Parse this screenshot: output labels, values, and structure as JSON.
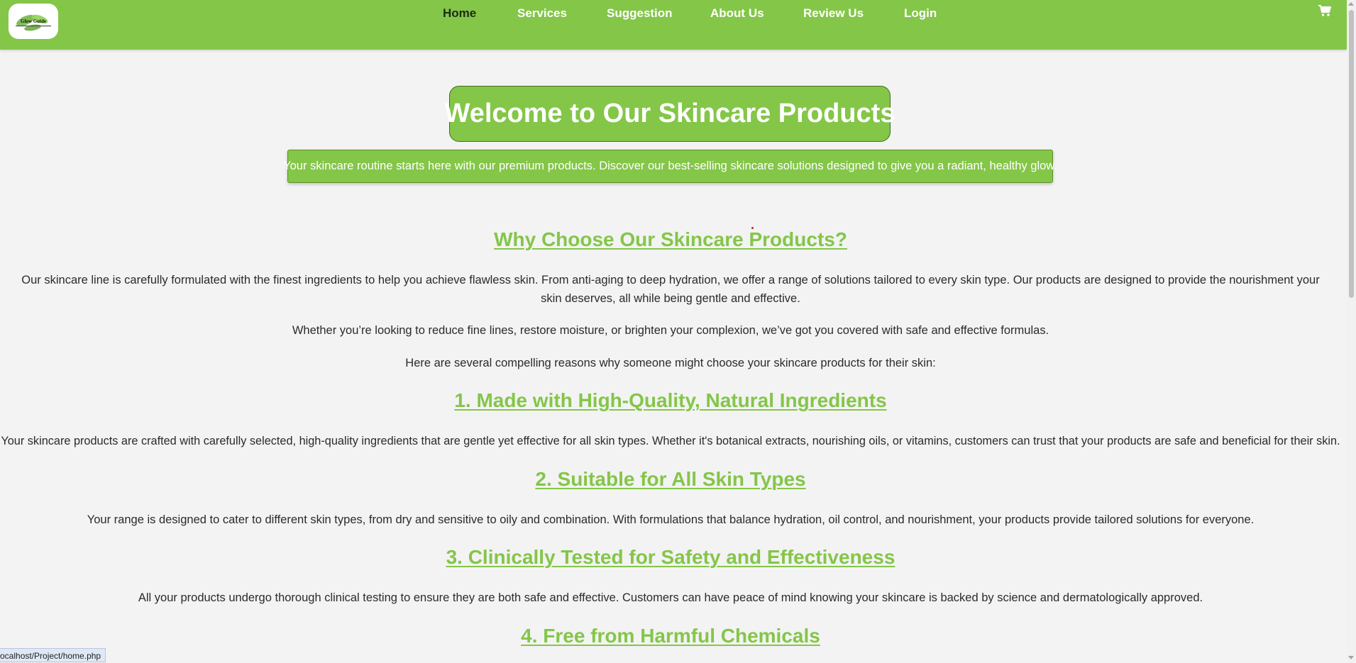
{
  "nav": {
    "logo_text": "Glow Guide",
    "items": [
      "Home",
      "Services",
      "Suggestion",
      "About Us",
      "Review Us",
      "Login"
    ],
    "active": "Home"
  },
  "hero": {
    "title": "Welcome to Our Skincare Products",
    "subtitle": "Your skincare routine starts here with our premium products. Discover our best-selling skincare solutions designed to give you a radiant, healthy glow."
  },
  "why": {
    "heading": "Why Choose Our Skincare Products?",
    "p1": "Our skincare line is carefully formulated with the finest ingredients to help you achieve flawless skin. From anti-aging to deep hydration, we offer a range of solutions tailored to every skin type. Our products are designed to provide the nourishment your skin deserves, all while being gentle and effective.",
    "p2": "Whether you’re looking to reduce fine lines, restore moisture, or brighten your complexion, we’ve got you covered with safe and effective formulas.",
    "p3": "Here are several compelling reasons why someone might choose your skincare products for their skin:"
  },
  "reasons": [
    {
      "heading": "1. Made with High-Quality, Natural Ingredients",
      "text": "Your skincare products are crafted with carefully selected, high-quality ingredients that are gentle yet effective for all skin types. Whether it's botanical extracts, nourishing oils, or vitamins, customers can trust that your products are safe and beneficial for their skin."
    },
    {
      "heading": "2. Suitable for All Skin Types",
      "text": "Your range is designed to cater to different skin types, from dry and sensitive to oily and combination. With formulations that balance hydration, oil control, and nourishment, your products provide tailored solutions for everyone."
    },
    {
      "heading": "3. Clinically Tested for Safety and Effectiveness",
      "text": "All your products undergo thorough clinical testing to ensure they are both safe and effective. Customers can have peace of mind knowing your skincare is backed by science and dermatologically approved."
    },
    {
      "heading": "4. Free from Harmful Chemicals"
    }
  ],
  "status_url": "ocalhost/Project/home.php",
  "colors": {
    "brand_green": "#84c648",
    "header_active_text": "#1f2b12",
    "page_bg": "#f3f3f3"
  },
  "icons": [
    "cart-icon",
    "logo-leaf-icon"
  ]
}
